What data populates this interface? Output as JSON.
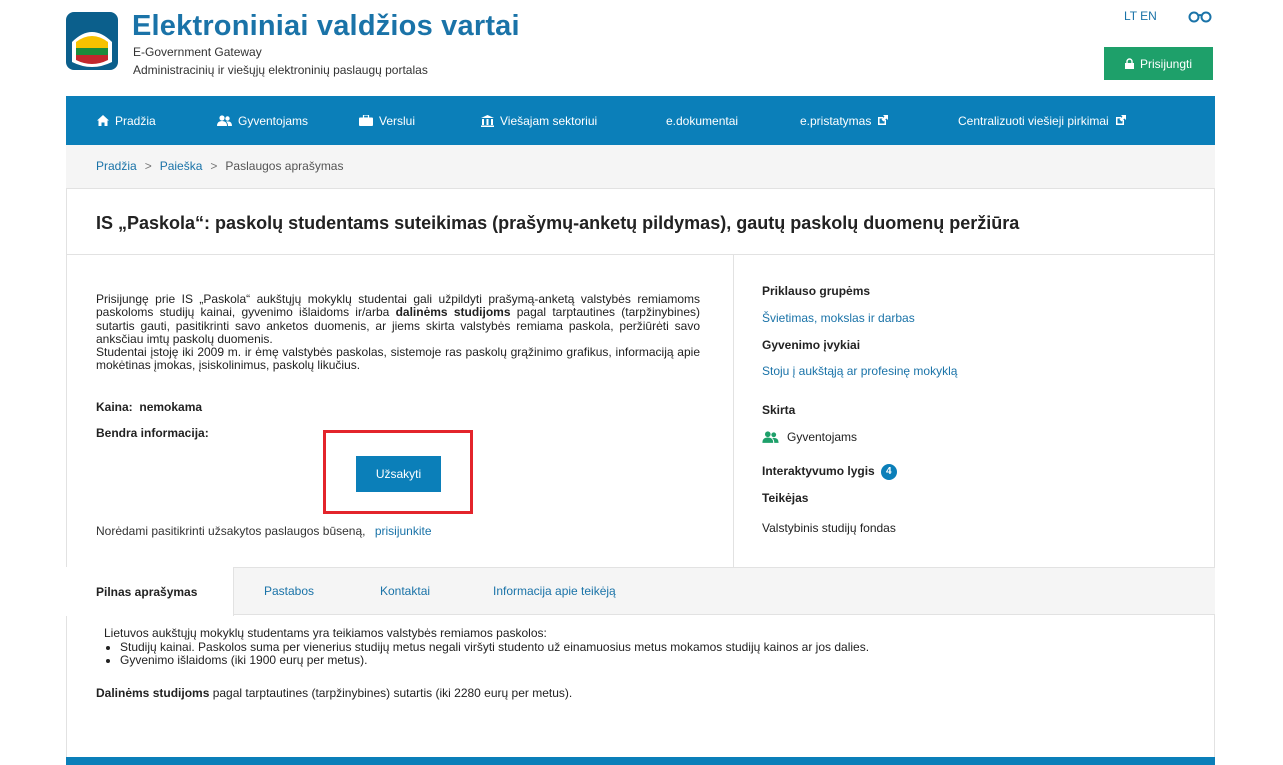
{
  "header": {
    "title": "Elektroniniai valdžios vartai",
    "subtitle": "E-Government Gateway",
    "tagline": "Administracinių ir viešųjų elektroninių paslaugų portalas",
    "lang_lt": "LT",
    "lang_en": "EN",
    "login_label": "Prisijungti"
  },
  "nav": {
    "items": [
      {
        "label": "Pradžia",
        "icon": "home-icon"
      },
      {
        "label": "Gyventojams",
        "icon": "users-icon"
      },
      {
        "label": "Verslui",
        "icon": "briefcase-icon"
      },
      {
        "label": "Viešajam sektoriui",
        "icon": "institution-icon"
      },
      {
        "label": "e.dokumentai",
        "icon": ""
      },
      {
        "label": "e.pristatymas",
        "icon": "external-link-icon"
      },
      {
        "label": "Centralizuoti viešieji pirkimai",
        "icon": "external-link-icon"
      }
    ]
  },
  "breadcrumb": {
    "items": [
      "Pradžia",
      "Paieška",
      "Paslaugos aprašymas"
    ],
    "separator": ">"
  },
  "page": {
    "title": "IS „Paskola“: paskolų studentams suteikimas (prašymų-anketų pildymas), gautų paskolų duomenų peržiūra"
  },
  "description": {
    "p1_a": "Prisijungę prie IS „Paskola“ aukštųjų mokyklų studentai gali užpildyti prašymą-anketą valstybės remiamoms paskoloms studijų kainai, gyvenimo išlaidoms ir/arba ",
    "p1_bold": "dalinėms studijoms",
    "p1_b": " pagal tarptautines (tarpžinybines) sutartis gauti, pasitikrinti savo anketos duomenis, ar jiems skirta valstybės remiama paskola, peržiūrėti savo anksčiau imtų paskolų duomenis.",
    "p2": "Studentai įstoję iki 2009 m. ir ėmę valstybės paskolas, sistemoje ras paskolų grąžinimo grafikus, informaciją apie mokėtinas įmokas, įsiskolinimus, paskolų likučius.",
    "price_label": "Kaina:",
    "price_value": "nemokama",
    "general_label": "Bendra informacija:",
    "order_label": "Užsakyti",
    "status_text": "Norėdami pasitikrinti užsakytos paslaugos būseną,",
    "status_link": "prisijunkite"
  },
  "sidebar": {
    "groups_label": "Priklauso grupėms",
    "groups_link": "Švietimas, mokslas ir darbas",
    "life_events_label": "Gyvenimo įvykiai",
    "life_events_link": "Stoju į aukštąją ar profesinę mokyklą",
    "target_label": "Skirta",
    "target_value": "Gyventojams",
    "interactivity_label": "Interaktyvumo lygis",
    "interactivity_value": "4",
    "provider_label": "Teikėjas",
    "provider_value": "Valstybinis studijų fondas"
  },
  "tabs": {
    "items": [
      "Pilnas aprašymas",
      "Pastabos",
      "Kontaktai",
      "Informacija apie teikėją"
    ],
    "active": 0
  },
  "full_description": {
    "intro": "Lietuvos aukštųjų mokyklų studentams yra teikiamos valstybės remiamos paskolos:",
    "bullets": [
      "Studijų kainai. Paskolos suma per vienerius studijų metus negali viršyti studento už einamuosius metus mokamos studijų kainos ar jos dalies.",
      "Gyvenimo išlaidoms (iki 1900 eurų per metus)."
    ],
    "last_bold": "Dalinėms studijoms",
    "last_rest": " pagal tarptautines (tarpžinybines) sutartis (iki 2280 eurų per metus)."
  },
  "colors": {
    "brand_blue": "#0b7fb9",
    "login_green": "#1ea06a",
    "highlight_red": "#e3242b"
  }
}
